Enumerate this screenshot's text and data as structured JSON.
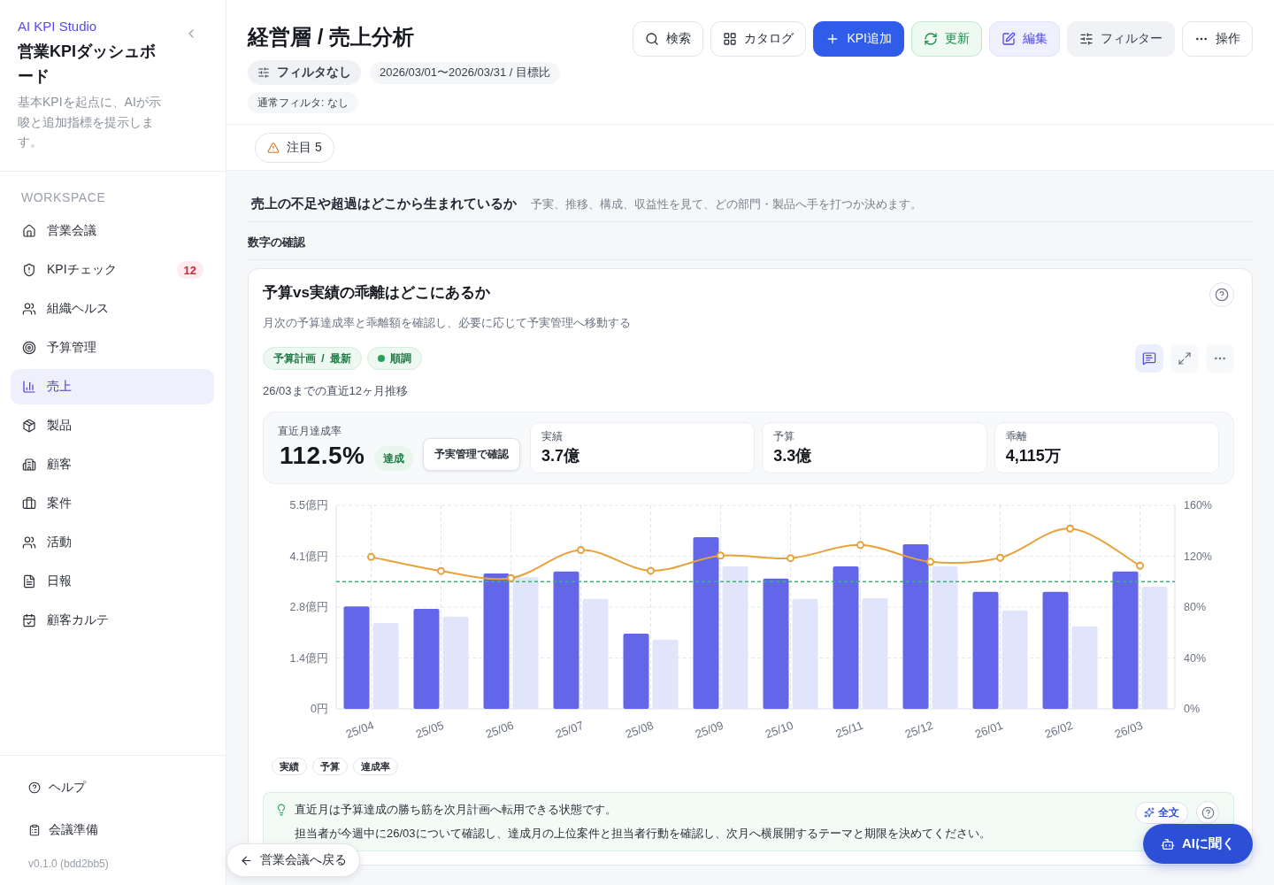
{
  "sidebar": {
    "brand": "AI KPI Studio",
    "title": "営業KPIダッシュボード",
    "description": "基本KPIを起点に、AIが示唆と追加指標を提示します。",
    "section_label": "WORKSPACE",
    "items": [
      {
        "label": "営業会議",
        "selected": false
      },
      {
        "label": "KPIチェック",
        "selected": false,
        "badge": "12"
      },
      {
        "label": "組織ヘルス",
        "selected": false
      },
      {
        "label": "予算管理",
        "selected": false
      },
      {
        "label": "売上",
        "selected": true
      },
      {
        "label": "製品",
        "selected": false
      },
      {
        "label": "顧客",
        "selected": false
      },
      {
        "label": "案件",
        "selected": false
      },
      {
        "label": "活動",
        "selected": false
      },
      {
        "label": "日報",
        "selected": false
      },
      {
        "label": "顧客カルテ",
        "selected": false
      }
    ],
    "footer_items": [
      "ヘルプ",
      "会議準備"
    ],
    "version": "v0.1.0 (bdd2bb5)"
  },
  "header": {
    "title": "経営層 / 売上分析",
    "chips": [
      {
        "label": "フィルタなし",
        "kind": "filter"
      },
      {
        "label": "2026/03/01〜2026/03/31 / 目標比",
        "kind": "period"
      },
      {
        "label": "通常フィルタ: なし",
        "kind": "note"
      }
    ],
    "actions": [
      {
        "label": "検索",
        "kind": "outline"
      },
      {
        "label": "カタログ",
        "kind": "outline"
      },
      {
        "label": "KPI追加",
        "kind": "primary"
      },
      {
        "label": "更新",
        "kind": "success"
      },
      {
        "label": "編集",
        "kind": "accent"
      },
      {
        "label": "フィルター",
        "kind": "muted"
      },
      {
        "label": "操作",
        "kind": "outline"
      }
    ]
  },
  "attention_chip": "注目 5",
  "section": {
    "title": "売上の不足や超過はどこから生まれているか",
    "description": "予実、推移、構成、収益性を見て、どの部門・製品へ手を打つか決めます。"
  },
  "subsection_title": "数字の確認",
  "card": {
    "title": "予算vs実績の乖離はどこにあるか",
    "description": "月次の予算達成率と乖離額を確認し、必要に応じて予実管理へ移動する",
    "tags": [
      {
        "label": "予算計画 / 最新",
        "kind": "source"
      },
      {
        "label": "順調",
        "kind": "status"
      }
    ],
    "tools": [
      {
        "selected": true
      },
      {
        "selected": false
      },
      {
        "selected": false
      }
    ],
    "subtitle": "26/03までの直近12ヶ月推移",
    "headline": {
      "label": "直近月達成率",
      "value": "112.5%",
      "badge": "達成",
      "button": "予実管理で確認"
    },
    "metrics": [
      {
        "label": "実績",
        "value": "3.7億"
      },
      {
        "label": "予算",
        "value": "3.3億"
      },
      {
        "label": "乖離",
        "value": "4,115万"
      }
    ],
    "chart_data": {
      "type": "bar",
      "categories": [
        "25/04",
        "25/05",
        "25/06",
        "25/07",
        "25/08",
        "25/09",
        "25/10",
        "25/11",
        "25/12",
        "26/01",
        "26/02",
        "26/03"
      ],
      "series": [
        {
          "name": "実績",
          "color": "#6366e8",
          "values": [
            2.77,
            2.7,
            3.66,
            3.71,
            2.03,
            4.64,
            3.52,
            3.85,
            4.45,
            3.16,
            3.16,
            3.71
          ]
        },
        {
          "name": "予算",
          "color": "#e0e5fb",
          "values": [
            2.32,
            2.49,
            3.56,
            2.97,
            1.87,
            3.85,
            2.97,
            2.99,
            3.85,
            2.66,
            2.23,
            3.3
          ]
        },
        {
          "name": "達成率",
          "type": "line",
          "axis": "y2",
          "marker": "o",
          "color": "#e8a23c",
          "values": [
            119.4,
            108.4,
            102.8,
            124.9,
            108.6,
            120.5,
            118.5,
            128.8,
            115.6,
            118.8,
            141.7,
            112.5
          ]
        }
      ],
      "ylim": [
        0,
        5.5
      ],
      "yticks": [
        {
          "value": 0,
          "label": "0円"
        },
        {
          "value": 1.375,
          "label": "1.4億円"
        },
        {
          "value": 2.75,
          "label": "2.8億円"
        },
        {
          "value": 4.125,
          "label": "4.1億円"
        },
        {
          "value": 5.5,
          "label": "5.5億円"
        }
      ],
      "y2lim": [
        0,
        160
      ],
      "y2ticks": [
        {
          "value": 0,
          "label": "0%"
        },
        {
          "value": 40,
          "label": "40%"
        },
        {
          "value": 80,
          "label": "80%"
        },
        {
          "value": 120,
          "label": "120%"
        },
        {
          "value": 160,
          "label": "160%"
        }
      ],
      "grid": true,
      "ref_lines": [
        {
          "value": 100,
          "axis": "y2",
          "color": "#3fb274"
        }
      ]
    },
    "insight": {
      "lines": [
        "直近月は予算達成の勝ち筋を次月計画へ転用できる状態です。",
        "担当者が今週中に26/03について確認し、達成月の上位案件と担当者行動を確認し、次月へ横展開するテーマと期限を決めてください。"
      ],
      "button": "全文"
    }
  },
  "back_button": "営業会議へ戻る",
  "ask_ai_button": "AIに聞く"
}
